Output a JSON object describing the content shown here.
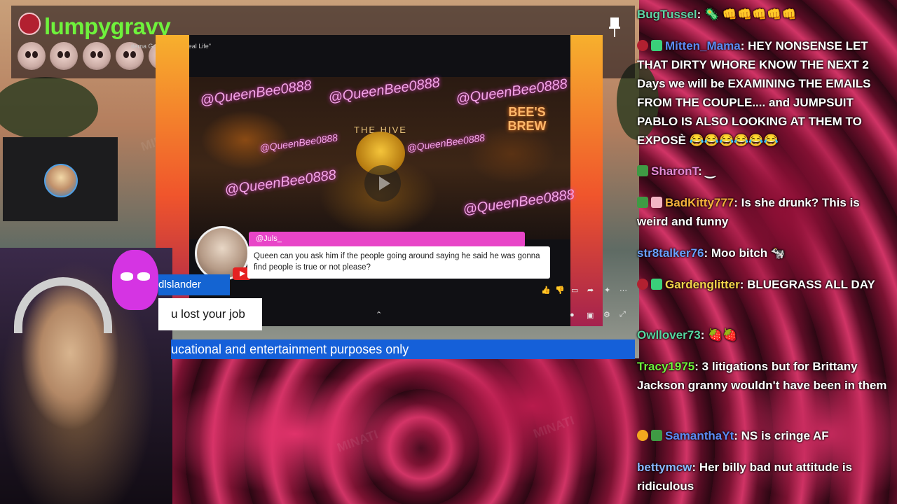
{
  "stream": {
    "channel_name": "lumpygravy",
    "video_title_fragment": "Beyond \"Real Life\"",
    "video_title_prefix": "itema",
    "video_title_mid": "Go"
  },
  "video": {
    "neon_tags": [
      "@QueenBee0888",
      "@QueenBee0888",
      "@QueenBee0888",
      "@QueenBee0888",
      "@QueenBee0888",
      "@QueenBee0888",
      "@QueenBee0888"
    ],
    "bees_brew": "BEE'S BREW",
    "hive_sign": "THE HIVE",
    "comment_user": "@Juls_",
    "comment_text": "Queen can you ask him if the people going around saying he said he was gonna find people is true or not please?"
  },
  "overlay": {
    "lower_name": "dlslander",
    "lower_message": "u lost your job",
    "ticker": "ucational and entertainment purposes only"
  },
  "chat": {
    "messages": [
      {
        "user": "BugTussel",
        "user_color": "#5fd6a6",
        "text": "",
        "emotes": "🦠 👊👊👊👊👊"
      },
      {
        "user": "Mitten_Mama",
        "user_color": "#5d8bf4",
        "text": "HEY NONSENSE LET THAT DIRTY WHORE KNOW THE NEXT 2 Days we will be EXAMINING THE EMAILS FROM THE COUPLE.... and JUMPSUIT PABLO IS ALSO LOOKING AT THEM TO EXPOSÈ 😂😂😂😂😂😂",
        "badges": [
          "mod",
          "gift"
        ]
      },
      {
        "user": "SharonT",
        "user_color": "#e88ad8",
        "text": "‿",
        "badges": [
          "leaf"
        ]
      },
      {
        "user": "BadKitty777",
        "user_color": "#f5b13b",
        "text": "Is she drunk? This is weird and funny",
        "badges": [
          "leaf",
          "gift"
        ]
      },
      {
        "user": "str8talker76",
        "user_color": "#6aa0ff",
        "text": "Moo bitch 🐄"
      },
      {
        "user": "Gardenglitter",
        "user_color": "#f3d24a",
        "text": "BLUEGRASS ALL DAY",
        "badges": [
          "mod",
          "gift"
        ]
      },
      {
        "user": "Owllover73",
        "user_color": "#57d6a0",
        "text": "🍓🍓"
      },
      {
        "user": "Tracy1975",
        "user_color": "#6ff23c",
        "text": "3 litigations but for Brittany Jackson granny wouldn't have been in them"
      },
      {
        "user": "SamanthaYt",
        "user_color": "#5d8bf4",
        "text": "NS is cringe AF",
        "badges": [
          "one",
          "leaf"
        ]
      },
      {
        "user": "bettymcw",
        "user_color": "#8ab8ff",
        "text": "Her billy bad nut attitude is ridiculous"
      }
    ]
  },
  "watermark_text": "MINATI",
  "colors": {
    "channel_name": "#6ff23c",
    "ticker_bg": "#1560d9",
    "mask": "#d534e3"
  }
}
